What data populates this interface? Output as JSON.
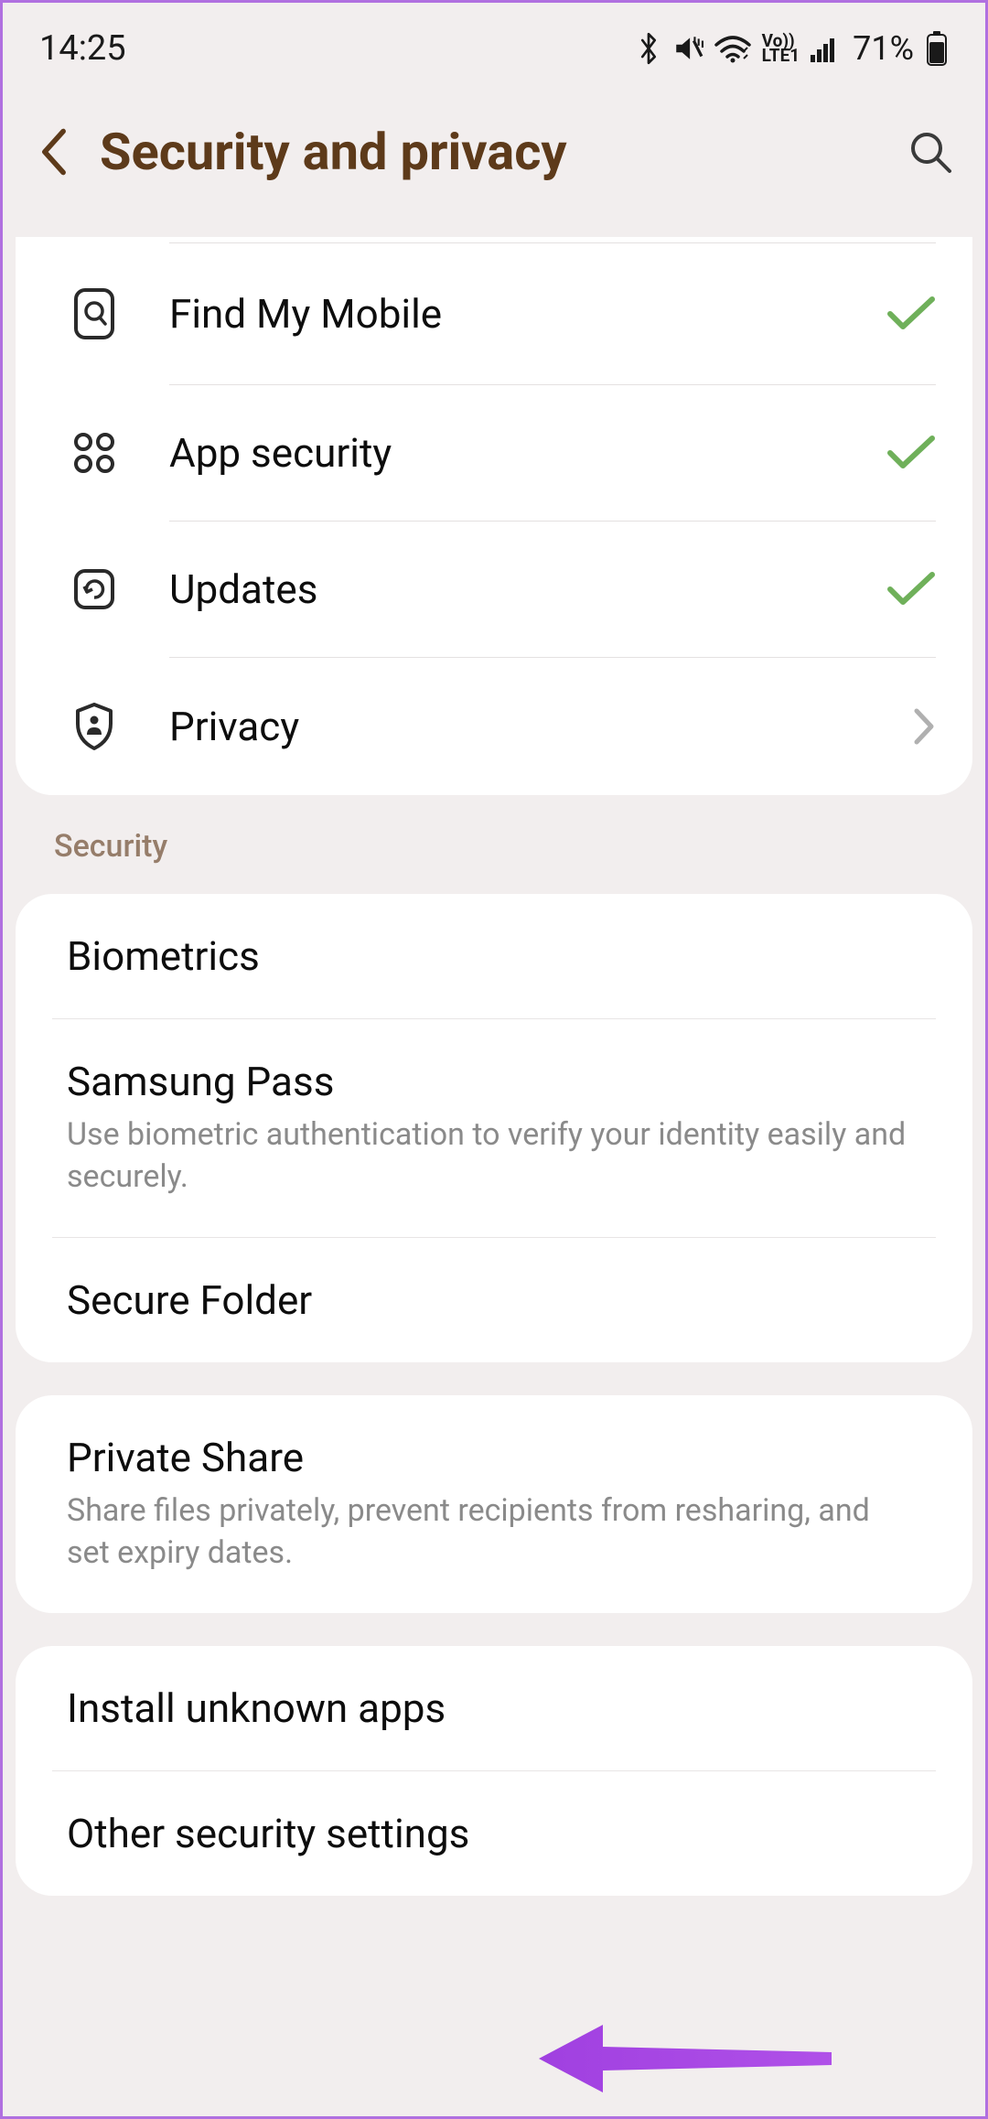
{
  "status": {
    "time": "14:25",
    "battery_text": "71%"
  },
  "header": {
    "title": "Security and privacy"
  },
  "dashboard": [
    {
      "label": "Find My Mobile",
      "icon": "find-mobile",
      "status": "check"
    },
    {
      "label": "App security",
      "icon": "apps",
      "status": "check"
    },
    {
      "label": "Updates",
      "icon": "updates",
      "status": "check"
    },
    {
      "label": "Privacy",
      "icon": "shield",
      "status": "chevron"
    }
  ],
  "section_security_label": "Security",
  "security_group": [
    {
      "title": "Biometrics"
    },
    {
      "title": "Samsung Pass",
      "sub": "Use biometric authentication to verify your identity easily and securely."
    },
    {
      "title": "Secure Folder"
    }
  ],
  "share_group": [
    {
      "title": "Private Share",
      "sub": "Share files privately, prevent recipients from resharing, and set expiry dates."
    }
  ],
  "other_group": [
    {
      "title": "Install unknown apps"
    },
    {
      "title": "Other security settings"
    }
  ]
}
